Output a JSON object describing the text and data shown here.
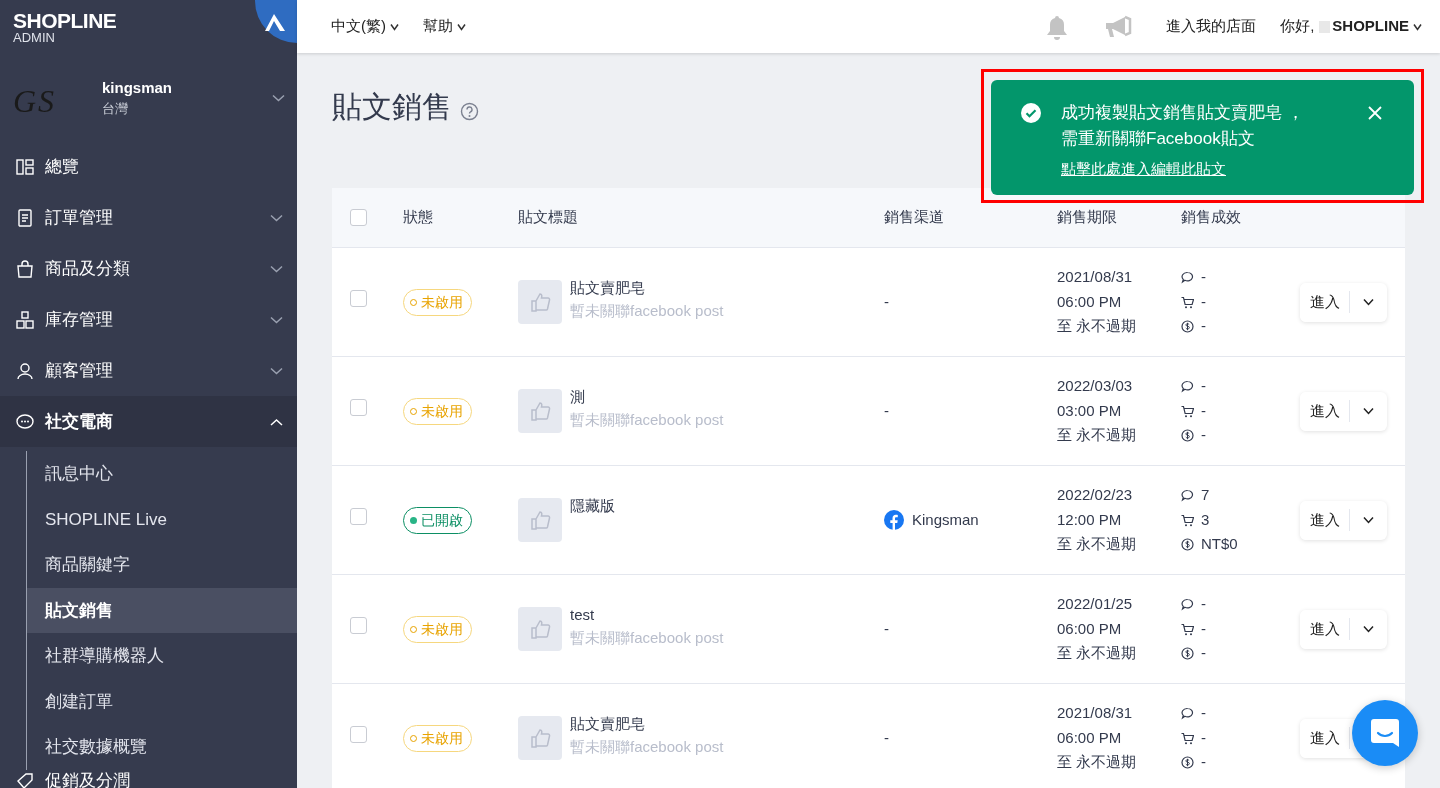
{
  "header": {
    "logo_title": "SHOPLINE",
    "logo_subtitle": "ADMIN",
    "menus": [
      {
        "label": "中文(繁)"
      },
      {
        "label": "幫助"
      }
    ],
    "storefront_link": "進入我的店面",
    "greeting": "你好,",
    "user": "SHOPLINE"
  },
  "store": {
    "logo_text": "GS",
    "name": "kingsman",
    "region": "台灣"
  },
  "sidebar": {
    "items": [
      {
        "label": "總覽"
      },
      {
        "label": "訂單管理",
        "expanded": false
      },
      {
        "label": "商品及分類",
        "expanded": false
      },
      {
        "label": "庫存管理",
        "expanded": false
      },
      {
        "label": "顧客管理",
        "expanded": false
      },
      {
        "label": "社交電商",
        "expanded": true,
        "children": [
          {
            "label": "訊息中心",
            "selected": false
          },
          {
            "label": "SHOPLINE Live",
            "selected": false
          },
          {
            "label": "商品關鍵字",
            "selected": false
          },
          {
            "label": "貼文銷售",
            "selected": true
          },
          {
            "label": "社群導購機器人",
            "selected": false
          },
          {
            "label": "創建訂單",
            "selected": false
          },
          {
            "label": "社交數據概覽",
            "selected": false
          }
        ]
      },
      {
        "label": "促銷及分潤"
      }
    ]
  },
  "page": {
    "title": "貼文銷售"
  },
  "table": {
    "header_checked": false,
    "columns": [
      "狀態",
      "貼文標題",
      "銷售渠道",
      "銷售期限",
      "銷售成效"
    ],
    "rows": [
      {
        "checked": false,
        "status": {
          "label": "未啟用",
          "active": false
        },
        "title": "貼文賣肥皂",
        "subtitle": "暫未關聯facebook post",
        "channel": {
          "label": "-"
        },
        "period": [
          "2021/08/31",
          "06:00 PM",
          "至 永不過期"
        ],
        "stats": {
          "comments": "-",
          "orders": "-",
          "sales": "-"
        },
        "action": "進入"
      },
      {
        "checked": false,
        "status": {
          "label": "未啟用",
          "active": false
        },
        "title": "測",
        "subtitle": "暫未關聯facebook post",
        "channel": {
          "label": "-"
        },
        "period": [
          "2022/03/03",
          "03:00 PM",
          "至 永不過期"
        ],
        "stats": {
          "comments": "-",
          "orders": "-",
          "sales": "-"
        },
        "action": "進入"
      },
      {
        "checked": false,
        "status": {
          "label": "已開啟",
          "active": true
        },
        "title": "隱藏版",
        "channel": {
          "label": "Kingsman",
          "kind": "facebook"
        },
        "period": [
          "2022/02/23",
          "12:00 PM",
          "至 永不過期"
        ],
        "stats": {
          "comments": "7",
          "orders": "3",
          "sales": "NT$0"
        },
        "action": "進入"
      },
      {
        "checked": false,
        "status": {
          "label": "未啟用",
          "active": false
        },
        "title": "test",
        "subtitle": "暫未關聯facebook post",
        "channel": {
          "label": "-"
        },
        "period": [
          "2022/01/25",
          "06:00 PM",
          "至 永不過期"
        ],
        "stats": {
          "comments": "-",
          "orders": "-",
          "sales": "-"
        },
        "action": "進入"
      },
      {
        "checked": false,
        "status": {
          "label": "未啟用",
          "active": false
        },
        "title": "貼文賣肥皂",
        "subtitle": "暫未關聯facebook post",
        "channel": {
          "label": "-"
        },
        "period": [
          "2021/08/31",
          "06:00 PM",
          "至 永不過期"
        ],
        "stats": {
          "comments": "-",
          "orders": "-",
          "sales": "-"
        },
        "action": "進入"
      }
    ]
  },
  "toast": {
    "message_lines": [
      "成功複製貼文銷售貼文賣肥皂 ，",
      "需重新關聯Facebook貼文"
    ],
    "link": "點擊此處進入編輯此貼文",
    "highlighted": true
  }
}
